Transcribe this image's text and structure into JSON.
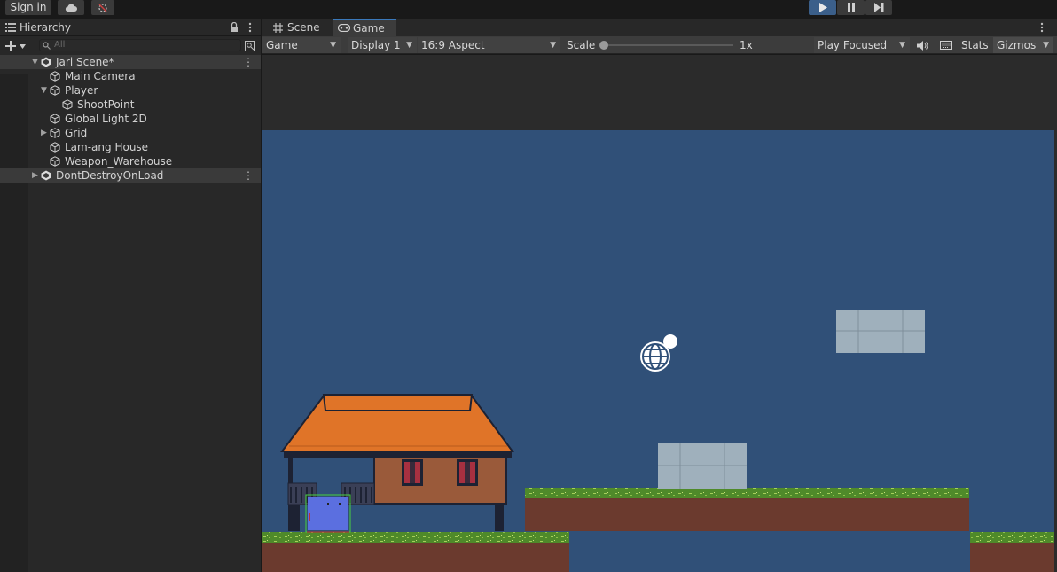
{
  "toolbar": {
    "sign_in": "Sign in",
    "play_active": true
  },
  "hierarchy": {
    "title": "Hierarchy",
    "search_placeholder": "All",
    "items": [
      {
        "label": "Jari Scene*",
        "depth": 0,
        "expanded": true,
        "type": "scene"
      },
      {
        "label": "Main Camera",
        "depth": 1,
        "type": "object"
      },
      {
        "label": "Player",
        "depth": 1,
        "expanded": true,
        "type": "object"
      },
      {
        "label": "ShootPoint",
        "depth": 2,
        "type": "object"
      },
      {
        "label": "Global Light 2D",
        "depth": 1,
        "type": "object"
      },
      {
        "label": "Grid",
        "depth": 1,
        "expanded": false,
        "type": "object"
      },
      {
        "label": "Lam-ang House",
        "depth": 1,
        "type": "object"
      },
      {
        "label": "Weapon_Warehouse",
        "depth": 1,
        "type": "object"
      },
      {
        "label": "DontDestroyOnLoad",
        "depth": 0,
        "expanded": false,
        "type": "scene"
      }
    ]
  },
  "tabs": {
    "scene": "Scene",
    "game": "Game"
  },
  "game_bar": {
    "mode": "Game",
    "display": "Display 1",
    "aspect": "16:9 Aspect",
    "scale_label": "Scale",
    "scale_value": "1x",
    "play_focused": "Play Focused",
    "stats": "Stats",
    "gizmos": "Gizmos"
  },
  "colors": {
    "sky": "#305078",
    "roof": "#e07428",
    "wall": "#9a5a3a",
    "grass": "#4f8a2a",
    "dirt": "#6b3a2e",
    "block": "#9fb0bc",
    "player": "#5b6fe0",
    "accent": "#3a79bb"
  }
}
